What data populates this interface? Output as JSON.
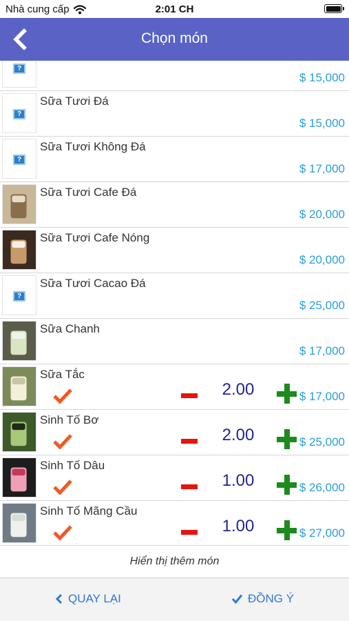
{
  "status_bar": {
    "carrier": "Nhà cung cấp",
    "time": "2:01 CH"
  },
  "nav": {
    "title": "Chọn món",
    "back_icon": "chevron-left-icon"
  },
  "colors": {
    "nav_bg": "#5a63c5",
    "price": "#2a9fd8",
    "quantity": "#22268f",
    "minus": "#e8120e",
    "plus": "#1c8a1c",
    "check": "#f05a24",
    "footer_link": "#2e79d6"
  },
  "items": [
    {
      "name": "",
      "price": "$ 15,000",
      "image": "placeholder"
    },
    {
      "name": "Sữa Tươi Đá",
      "price": "$ 15,000",
      "image": "placeholder"
    },
    {
      "name": "Sữa Tươi Không Đá",
      "price": "$ 17,000",
      "image": "placeholder"
    },
    {
      "name": "Sữa Tươi Cafe Đá",
      "price": "$ 20,000",
      "image": "photo"
    },
    {
      "name": "Sữa Tươi Cafe Nóng",
      "price": "$ 20,000",
      "image": "photo"
    },
    {
      "name": "Sữa Tươi Cacao Đá",
      "price": "$ 25,000",
      "image": "placeholder"
    },
    {
      "name": "Sữa Chanh",
      "price": "$ 17,000",
      "image": "photo"
    },
    {
      "name": "Sữa Tắc",
      "price": "$ 17,000",
      "image": "photo",
      "selected": true,
      "quantity": "2.00"
    },
    {
      "name": "Sinh Tố Bơ",
      "price": "$ 25,000",
      "image": "photo",
      "selected": true,
      "quantity": "2.00"
    },
    {
      "name": "Sinh Tố Dâu",
      "price": "$ 26,000",
      "image": "photo",
      "selected": true,
      "quantity": "1.00"
    },
    {
      "name": "Sinh Tố Mãng Cầu",
      "price": "$ 27,000",
      "image": "photo",
      "selected": true,
      "quantity": "1.00"
    }
  ],
  "load_more": "Hiển thị thêm món",
  "footer": {
    "back_label": "QUAY LẠI",
    "back_icon": "chevron-left-icon",
    "confirm_label": "ĐỒNG Ý",
    "confirm_icon": "checkmark-icon"
  }
}
